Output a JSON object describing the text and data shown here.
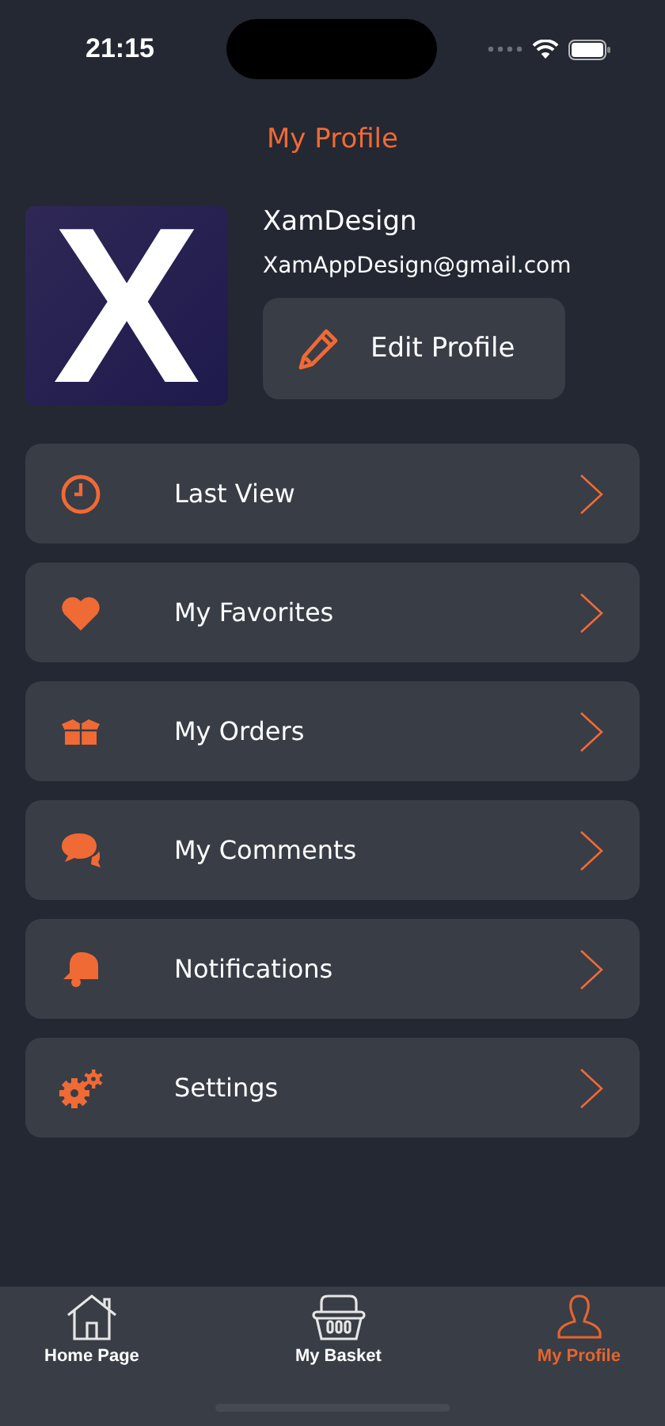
{
  "status_bar": {
    "time": "21:15"
  },
  "header": {
    "title": "My Profile"
  },
  "profile": {
    "logo_text": "X",
    "name": "XamDesign",
    "email": "XamAppDesign@gmail.com",
    "edit_button": "Edit Profile"
  },
  "menu": [
    {
      "kind": "clock",
      "label": "Last View"
    },
    {
      "kind": "heart",
      "label": "My Favorites"
    },
    {
      "kind": "box",
      "label": "My Orders"
    },
    {
      "kind": "chat",
      "label": "My Comments"
    },
    {
      "kind": "bell",
      "label": "Notifications"
    },
    {
      "kind": "gears",
      "label": "Settings"
    }
  ],
  "tab_bar": [
    {
      "kind": "home",
      "label": "Home Page",
      "selected": false
    },
    {
      "kind": "basket",
      "label": "My Basket",
      "selected": false
    },
    {
      "kind": "person",
      "label": "My Profile",
      "selected": true
    }
  ]
}
